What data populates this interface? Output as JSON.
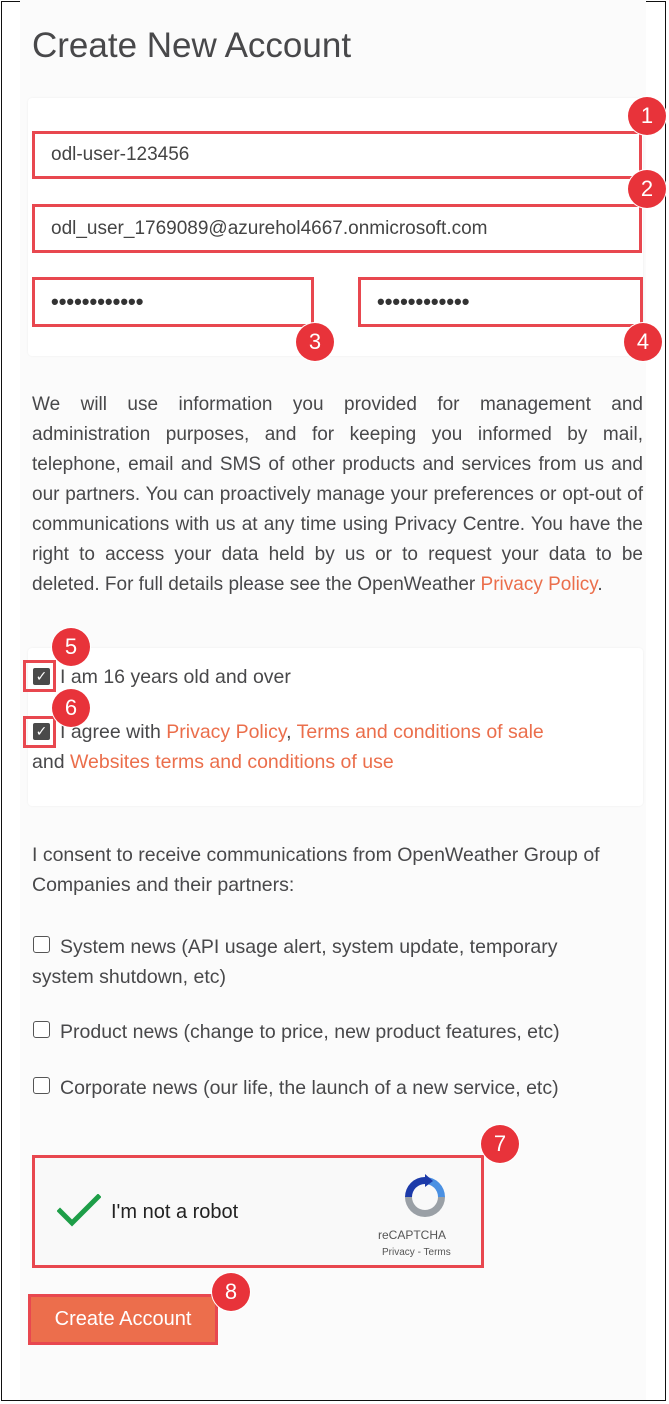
{
  "page": {
    "title": "Create New Account"
  },
  "form": {
    "username": "odl-user-123456",
    "email": "odl_user_1769089@azurehol4667.onmicrosoft.com",
    "password": "••••••••••••",
    "password_repeat": "••••••••••••"
  },
  "privacy_text": {
    "body": "We will use information you provided for management and administration purposes, and for keeping you informed by mail, telephone, email and SMS of other products and services from us and our partners. You can proactively manage your preferences or opt-out of communications with us at any time using Privacy Centre. You have the right to access your data held by us or to request your data to be deleted. For full details please see the OpenWeather ",
    "link": "Privacy Policy",
    "end": "."
  },
  "age_checkbox": {
    "label": "I am 16 years old and over",
    "checked": true
  },
  "agree_checkbox": {
    "prefix": "I agree with ",
    "link1": "Privacy Policy",
    "sep1": ", ",
    "link2": "Terms and conditions of sale",
    "sep2": " and ",
    "link3": "Websites terms and conditions of use",
    "checked": true
  },
  "consent": {
    "intro": "I consent to receive communications from OpenWeather Group of Companies and their partners:",
    "options": [
      {
        "label": "System news (API usage alert, system update, temporary system shutdown, etc)",
        "checked": false
      },
      {
        "label": "Product news (change to price, new product features, etc)",
        "checked": false
      },
      {
        "label": "Corporate news (our life, the launch of a new service, etc)",
        "checked": false
      }
    ]
  },
  "recaptcha": {
    "label": "I'm not a robot",
    "brand": "reCAPTCHA",
    "privacy": "Privacy",
    "sep": " - ",
    "terms": "Terms"
  },
  "submit_label": "Create Account",
  "markers": [
    "1",
    "2",
    "3",
    "4",
    "5",
    "6",
    "7",
    "8"
  ],
  "colors": {
    "accent": "#eb6e4b",
    "highlight": "#e8333a",
    "checkbox": "#4a4a4a"
  }
}
